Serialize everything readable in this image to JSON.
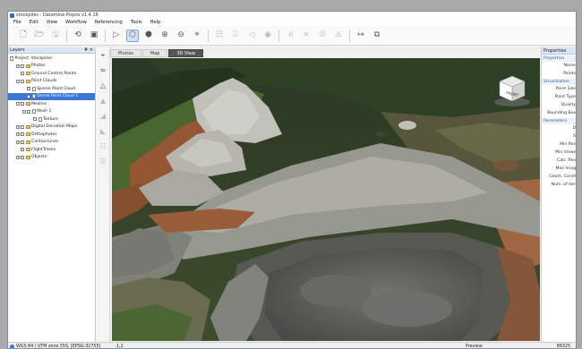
{
  "window": {
    "title": "stockpiles - Datamine Pixpro v1.4.16"
  },
  "menu": [
    "File",
    "Edit",
    "View",
    "Workflow",
    "Referencing",
    "Tools",
    "Help"
  ],
  "toolbar_icons": [
    "new-file-icon",
    "open-folder-icon",
    "save-icon",
    "import-icon",
    "image-icon",
    "run-icon",
    "3d-view-icon",
    "cube-icon",
    "zoom-in-icon",
    "zoom-out-icon",
    "zoom-fit-icon",
    "align-icon",
    "measure-icon",
    "flag-icon",
    "eye-icon",
    "point-add-icon",
    "point-edit-icon",
    "point-move-icon",
    "point-delete-icon",
    "crop-icon",
    "layers-icon"
  ],
  "layers_panel": {
    "title": "Layers",
    "pin": "#",
    "close": "✕",
    "items": [
      {
        "label": "Project 'stockpiles'",
        "level": 0,
        "type": "doc"
      },
      {
        "label": "Photos",
        "level": 1,
        "type": "folder",
        "expander": "+"
      },
      {
        "label": "Ground Control Points",
        "level": 1,
        "type": "folder",
        "expander": ""
      },
      {
        "label": "Point Clouds",
        "level": 1,
        "type": "folder",
        "expander": "−"
      },
      {
        "label": "Sparse Point Cloud",
        "level": 2,
        "type": "doc",
        "expander": ""
      },
      {
        "label": "Dense Point Cloud 1",
        "level": 2,
        "type": "doc",
        "expander": "",
        "selected": true
      },
      {
        "label": "Meshes",
        "level": 1,
        "type": "folder",
        "expander": "−"
      },
      {
        "label": "Mesh 1",
        "level": 2,
        "type": "doc",
        "expander": "−"
      },
      {
        "label": "Texture",
        "level": 3,
        "type": "doc",
        "expander": ""
      },
      {
        "label": "Digital Elevation Maps",
        "level": 1,
        "type": "folder",
        "expander": "+"
      },
      {
        "label": "Orthophotos",
        "level": 1,
        "type": "folder",
        "expander": "+"
      },
      {
        "label": "ContourLines",
        "level": 1,
        "type": "folder",
        "expander": "+"
      },
      {
        "label": "FlightTracks",
        "level": 1,
        "type": "folder",
        "expander": ""
      },
      {
        "label": "Objects",
        "level": 1,
        "type": "folder",
        "expander": "+"
      }
    ]
  },
  "tools_column": [
    "target-icon",
    "polyline-icon",
    "triangle-icon",
    "volume-icon",
    "stockpile-icon",
    "cut-icon",
    "layers-stack-icon",
    "export-icon"
  ],
  "view_tabs": [
    {
      "label": "Photos",
      "active": false
    },
    {
      "label": "Map",
      "active": false
    },
    {
      "label": "3D View",
      "active": true
    }
  ],
  "view_cube": {
    "face": "FRONT"
  },
  "properties_panel": {
    "title": "Properties",
    "sections": [
      {
        "name": "Properties",
        "rows": [
          "Name",
          "Points"
        ]
      },
      {
        "name": "Visualization",
        "rows": [
          "Point Size",
          "Point Type",
          "Quality",
          "Bounding Box"
        ]
      },
      {
        "name": "Parameters",
        "rows": [
          "D",
          "S",
          "Min Res",
          "Min Views",
          "Calc. Res",
          "Max Imag",
          "Geom. Const",
          "Num. of iter"
        ]
      }
    ]
  },
  "status": {
    "crs": "WGS 84 / UTM zone 55S, [EPSG:32755]",
    "coord": "1,2",
    "mode": "Preview",
    "count": "89325"
  }
}
